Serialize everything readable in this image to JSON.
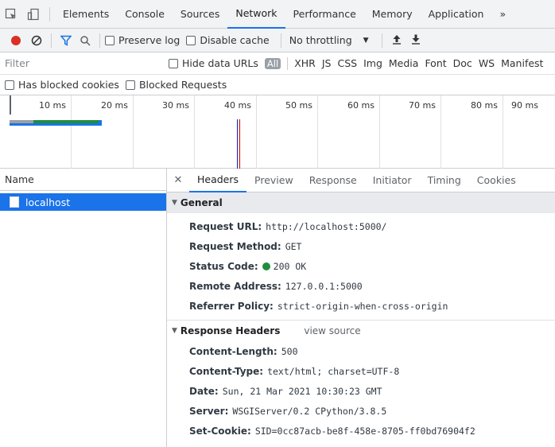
{
  "topbar": {
    "tabs": [
      {
        "label": "Elements",
        "active": false
      },
      {
        "label": "Console",
        "active": false
      },
      {
        "label": "Sources",
        "active": false
      },
      {
        "label": "Network",
        "active": true
      },
      {
        "label": "Performance",
        "active": false
      },
      {
        "label": "Memory",
        "active": false
      },
      {
        "label": "Application",
        "active": false
      }
    ],
    "overflow_label": "»"
  },
  "toolbar": {
    "preserve_log_label": "Preserve log",
    "disable_cache_label": "Disable cache",
    "throttling_label": "No throttling"
  },
  "filter": {
    "placeholder": "Filter",
    "hide_data_urls_label": "Hide data URLs",
    "types": [
      "All",
      "XHR",
      "JS",
      "CSS",
      "Img",
      "Media",
      "Font",
      "Doc",
      "WS",
      "Manifest"
    ]
  },
  "blocked": {
    "has_blocked_cookies_label": "Has blocked cookies",
    "blocked_requests_label": "Blocked Requests"
  },
  "overview": {
    "ticks": [
      "10 ms",
      "20 ms",
      "30 ms",
      "40 ms",
      "50 ms",
      "60 ms",
      "70 ms",
      "80 ms",
      "90 ms"
    ],
    "colors": {
      "waiting": "#9aa0a6",
      "receiving": "#1e8e3e",
      "download": "#1a73e8",
      "dcl": "#1a1aa6",
      "load": "#c80000"
    }
  },
  "requests": {
    "column_header": "Name",
    "items": [
      {
        "name": "localhost"
      }
    ]
  },
  "details": {
    "tabs": [
      "Headers",
      "Preview",
      "Response",
      "Initiator",
      "Timing",
      "Cookies"
    ],
    "active_tab": "Headers",
    "general": {
      "title": "General",
      "request_url_key": "Request URL:",
      "request_url": "http://localhost:5000/",
      "request_method_key": "Request Method:",
      "request_method": "GET",
      "status_code_key": "Status Code:",
      "status_code": "200 OK",
      "remote_address_key": "Remote Address:",
      "remote_address": "127.0.0.1:5000",
      "referrer_policy_key": "Referrer Policy:",
      "referrer_policy": "strict-origin-when-cross-origin"
    },
    "response_headers": {
      "title": "Response Headers",
      "view_source_label": "view source",
      "content_length_key": "Content-Length:",
      "content_length": "500",
      "content_type_key": "Content-Type:",
      "content_type": "text/html; charset=UTF-8",
      "date_key": "Date:",
      "date": "Sun, 21 Mar 2021 10:30:23 GMT",
      "server_key": "Server:",
      "server": "WSGIServer/0.2 CPython/3.8.5",
      "set_cookie_key": "Set-Cookie:",
      "set_cookie": "SID=0cc87acb-be8f-458e-8705-ff0bd76904f2"
    }
  }
}
